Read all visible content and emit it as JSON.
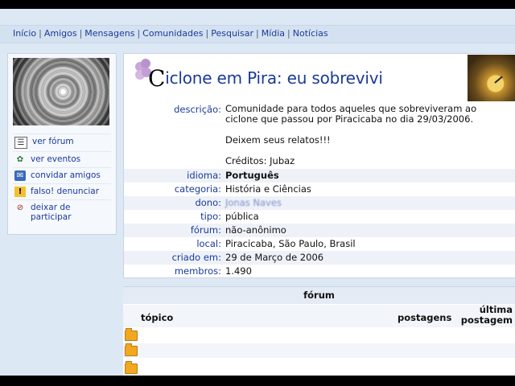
{
  "nav": {
    "items": [
      "Início",
      "Amigos",
      "Mensagens",
      "Comunidades",
      "Pesquisar",
      "Mídia",
      "Notícias"
    ],
    "separator": "|"
  },
  "sidebar": {
    "links": [
      {
        "label": "ver fórum",
        "icon": "forum-icon"
      },
      {
        "label": "ver eventos",
        "icon": "events-icon"
      },
      {
        "label": "convidar amigos",
        "icon": "invite-icon"
      },
      {
        "label": "falso! denunciar",
        "icon": "report-icon"
      },
      {
        "label": "deixar de participar",
        "icon": "leave-icon"
      }
    ]
  },
  "community": {
    "title_initial": "C",
    "title_rest": "iclone em Pira: eu sobrevivi",
    "fields": {
      "descricao_label": "descrição:",
      "descricao_lines": [
        "Comunidade para todos aqueles que sobreviveram ao ciclone que passou por Piracicaba no dia 29/03/2006.",
        "Deixem seus relatos!!!",
        "Créditos: Jubaz"
      ],
      "idioma_label": "idioma:",
      "idioma": "Português",
      "categoria_label": "categoria:",
      "categoria": "História e Ciências",
      "dono_label": "dono:",
      "dono": "Jonas Naves",
      "tipo_label": "tipo:",
      "tipo": "pública",
      "forum_label": "fórum:",
      "forum": "não-anônimo",
      "local_label": "local:",
      "local": "Piracicaba, São Paulo, Brasil",
      "criado_label": "criado em:",
      "criado": "29 de Março de 2006",
      "membros_label": "membros:",
      "membros": "1.490"
    }
  },
  "forum": {
    "heading": "fórum",
    "col_topic": "tópico",
    "col_posts": "postagens",
    "col_last_line1": "última",
    "col_last_line2": "postagem",
    "rows": [
      "",
      "",
      ""
    ]
  },
  "colors": {
    "link": "#1a3a9a",
    "page_bg": "#dce8f4"
  }
}
